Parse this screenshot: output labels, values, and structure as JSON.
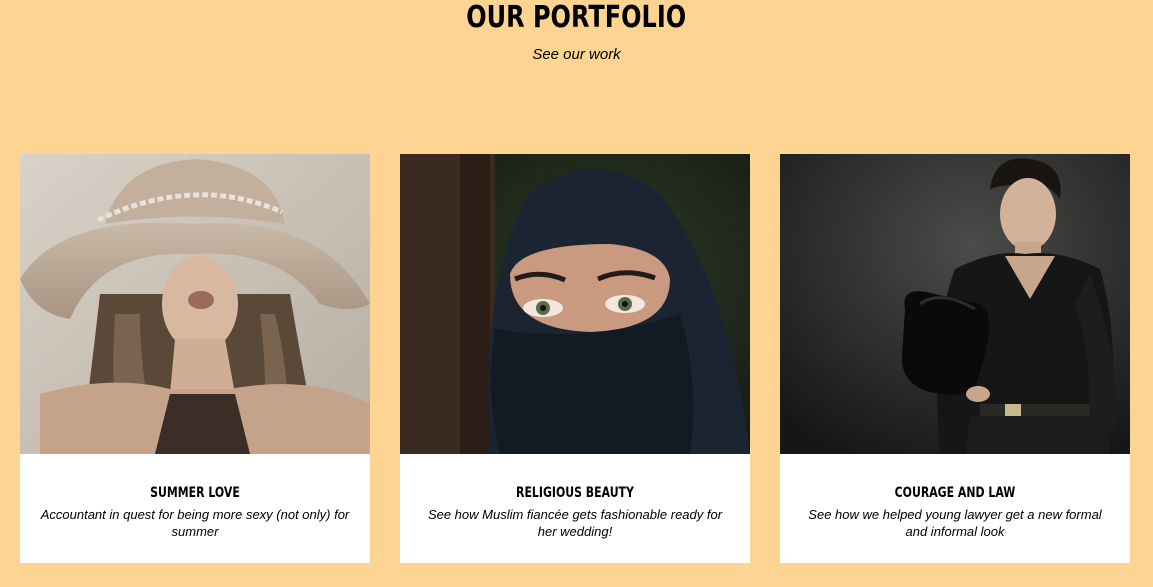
{
  "header": {
    "title": "OUR PORTFOLIO",
    "subtitle": "See our work"
  },
  "cards": [
    {
      "title": "SUMMER LOVE",
      "description": "Accountant in quest for being more sexy (not only) for summer",
      "image_icon": "woman-in-hat-photo"
    },
    {
      "title": "RELIGIOUS BEAUTY",
      "description": "See how Muslim fiancée gets fashionable ready for her wedding!",
      "image_icon": "woman-in-hijab-photo"
    },
    {
      "title": "COURAGE AND LAW",
      "description": "See how we helped young lawyer get a new formal and informal look",
      "image_icon": "man-with-bag-photo"
    }
  ],
  "colors": {
    "background": "#fdd491",
    "card": "#ffffff",
    "text": "#000000"
  }
}
